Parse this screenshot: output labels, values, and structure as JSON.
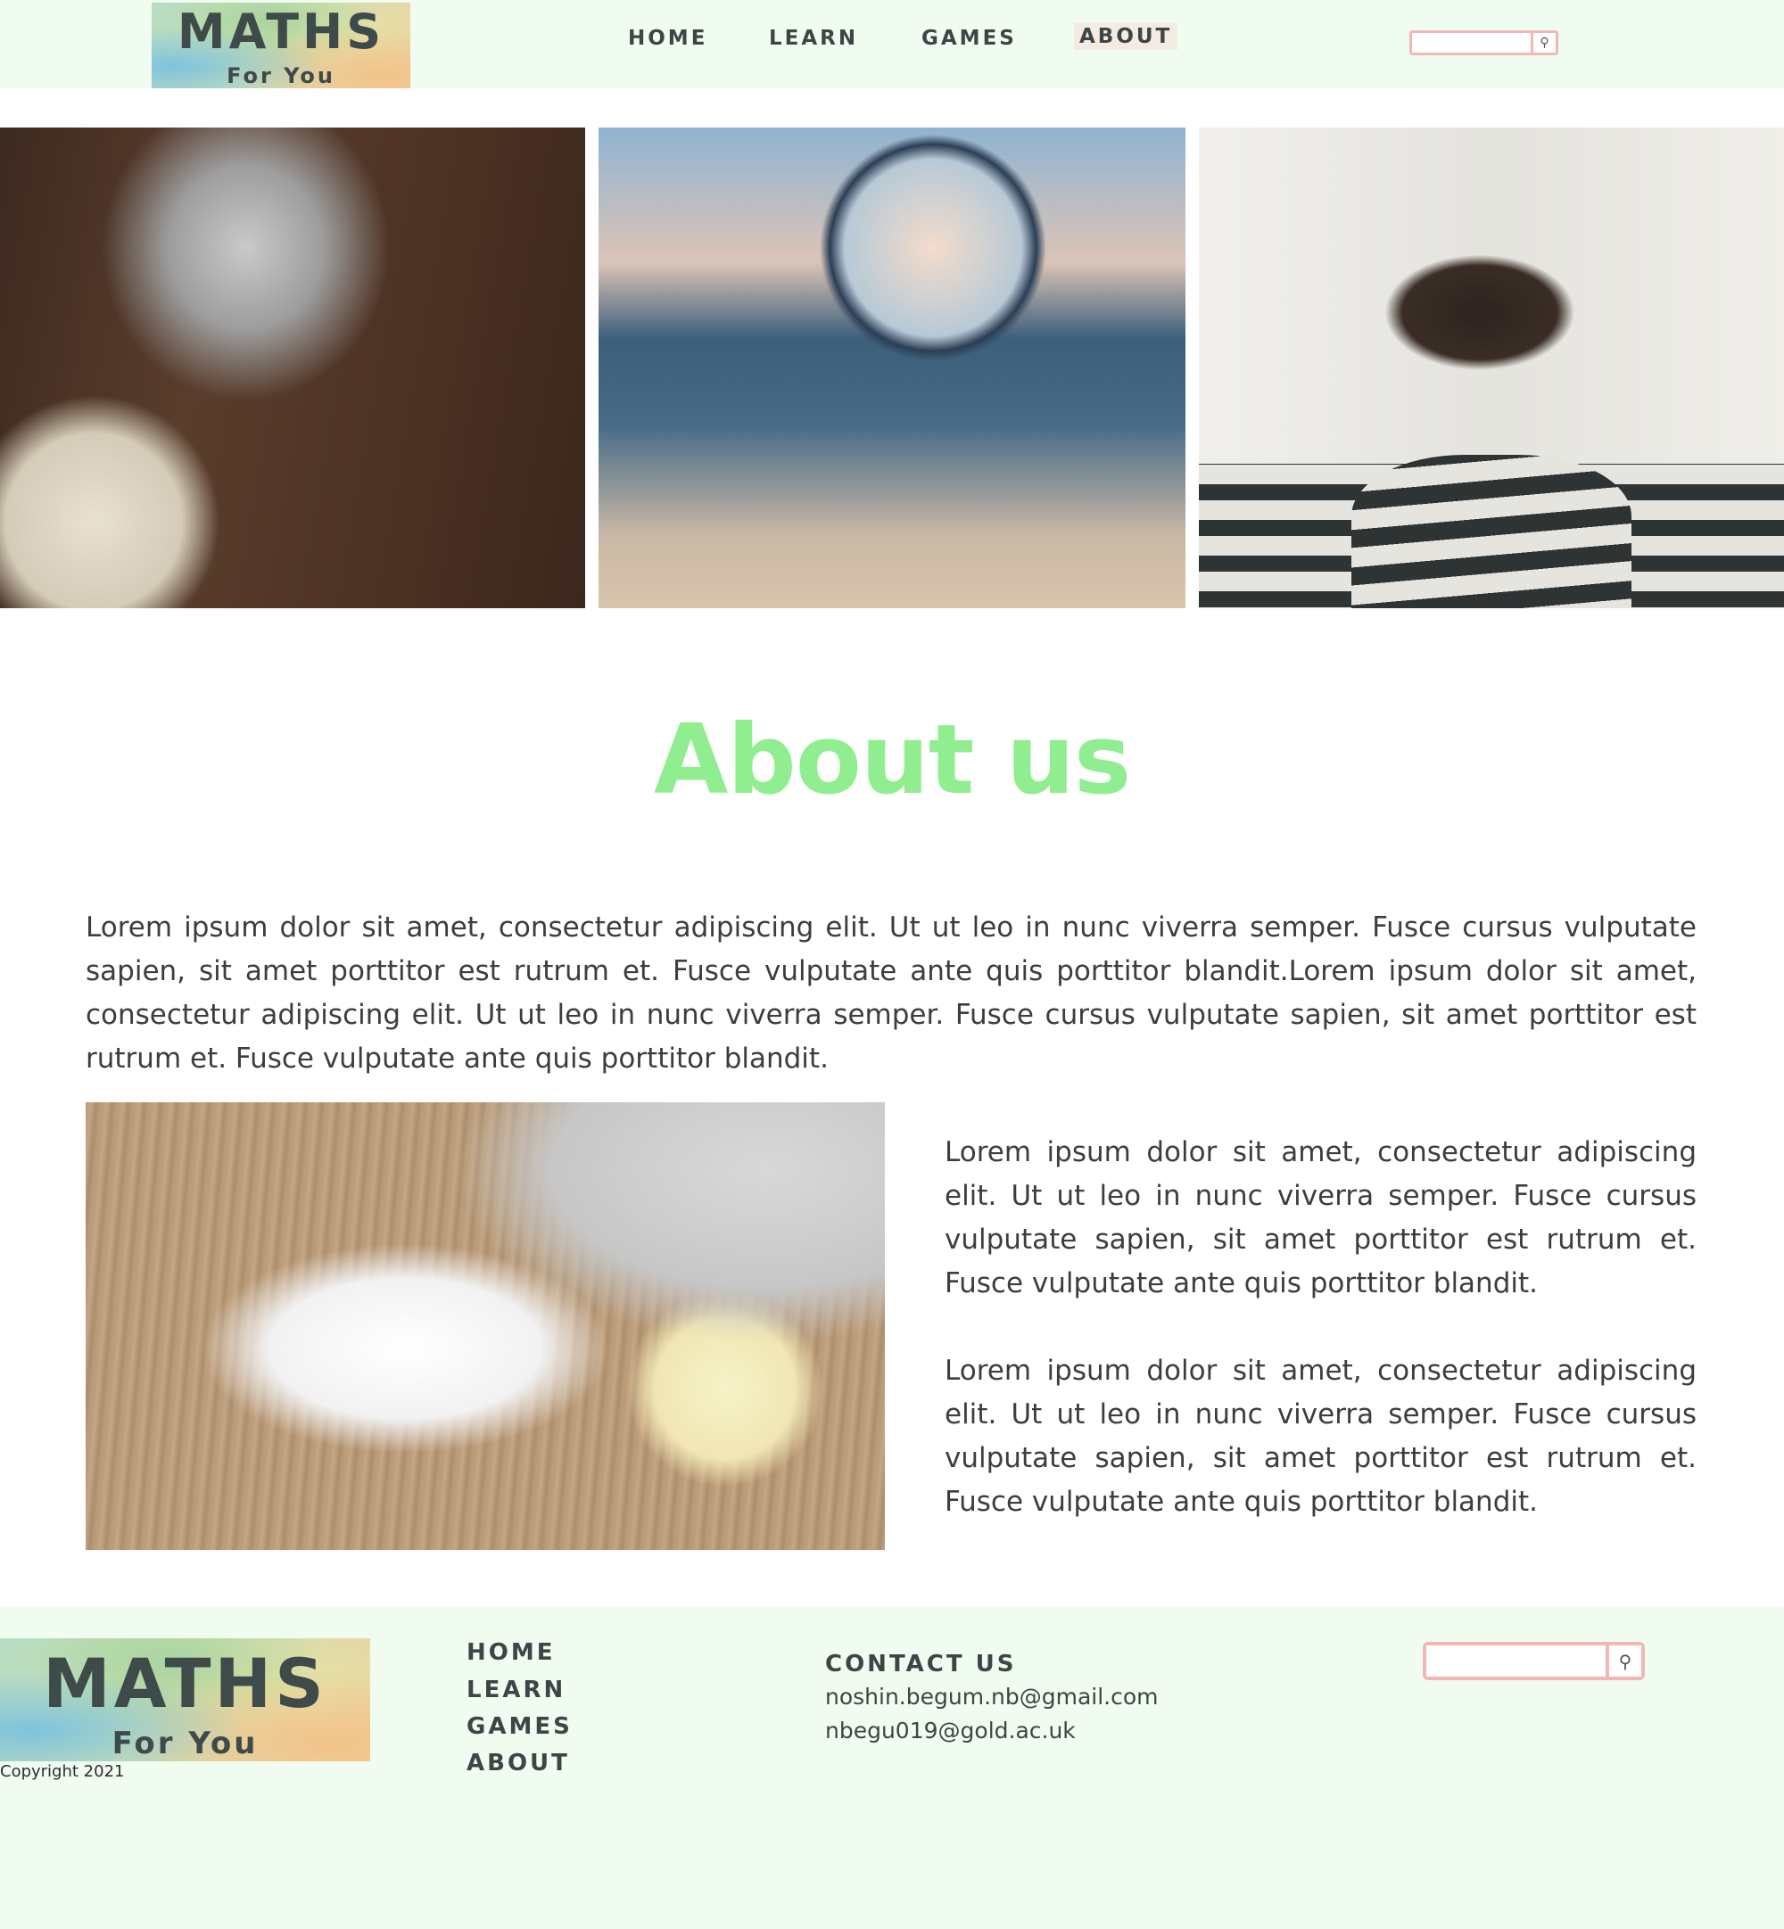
{
  "header": {
    "logo": {
      "title": "MATHS",
      "subtitle": "For You"
    },
    "nav": [
      {
        "label": "HOME"
      },
      {
        "label": "LEARN"
      },
      {
        "label": "GAMES"
      },
      {
        "label": "ABOUT",
        "active": true
      }
    ],
    "search": {
      "placeholder": "",
      "button_icon": "search-icon"
    }
  },
  "hero": {
    "images": [
      "laptop-desk-photo",
      "magnifying-glass-photo",
      "man-at-idea-board-photo"
    ]
  },
  "about": {
    "title": "About us",
    "paragraph_1": "Lorem ipsum dolor sit amet, consectetur adipiscing elit. Ut ut leo in nunc viverra semper. Fusce cursus vulputate sapien, sit amet porttitor est rutrum et. Fusce vulputate ante quis porttitor blandit.Lorem ipsum dolor sit amet, consectetur adipiscing elit. Ut ut leo in nunc viverra semper. Fusce cursus vulputate sapien, sit amet porttitor est rutrum et. Fusce vulputate ante quis porttitor blandit.",
    "paragraph_2": "Lorem ipsum dolor sit amet, consectetur adipiscing elit. Ut ut leo in nunc viverra semper. Fusce cursus vulputate sapien, sit amet porttitor est rutrum et. Fusce vulputate ante quis porttitor blandit.",
    "paragraph_3": "Lorem ipsum dolor sit amet, consectetur adipiscing elit. Ut ut leo in nunc viverra semper. Fusce cursus vulputate sapien, sit amet porttitor est rutrum et. Fusce vulputate ante quis porttitor blandit."
  },
  "footer": {
    "logo": {
      "title": "MATHS",
      "subtitle": "For You"
    },
    "copyright": "Copyright 2021",
    "nav": [
      {
        "label": "HOME"
      },
      {
        "label": "LEARN"
      },
      {
        "label": "GAMES"
      },
      {
        "label": "ABOUT"
      }
    ],
    "contact": {
      "title": "CONTACT US",
      "emails": [
        "noshin.begum.nb@gmail.com",
        "nbegu019@gold.ac.uk"
      ]
    },
    "search": {
      "placeholder": "",
      "button_icon": "search-icon"
    }
  },
  "colors": {
    "header_bg": "#f1fcf1",
    "title_green": "#90ee90",
    "search_border": "#f1b7b2",
    "active_nav_bg": "#f4ebe3",
    "text": "#3d3d3d"
  }
}
